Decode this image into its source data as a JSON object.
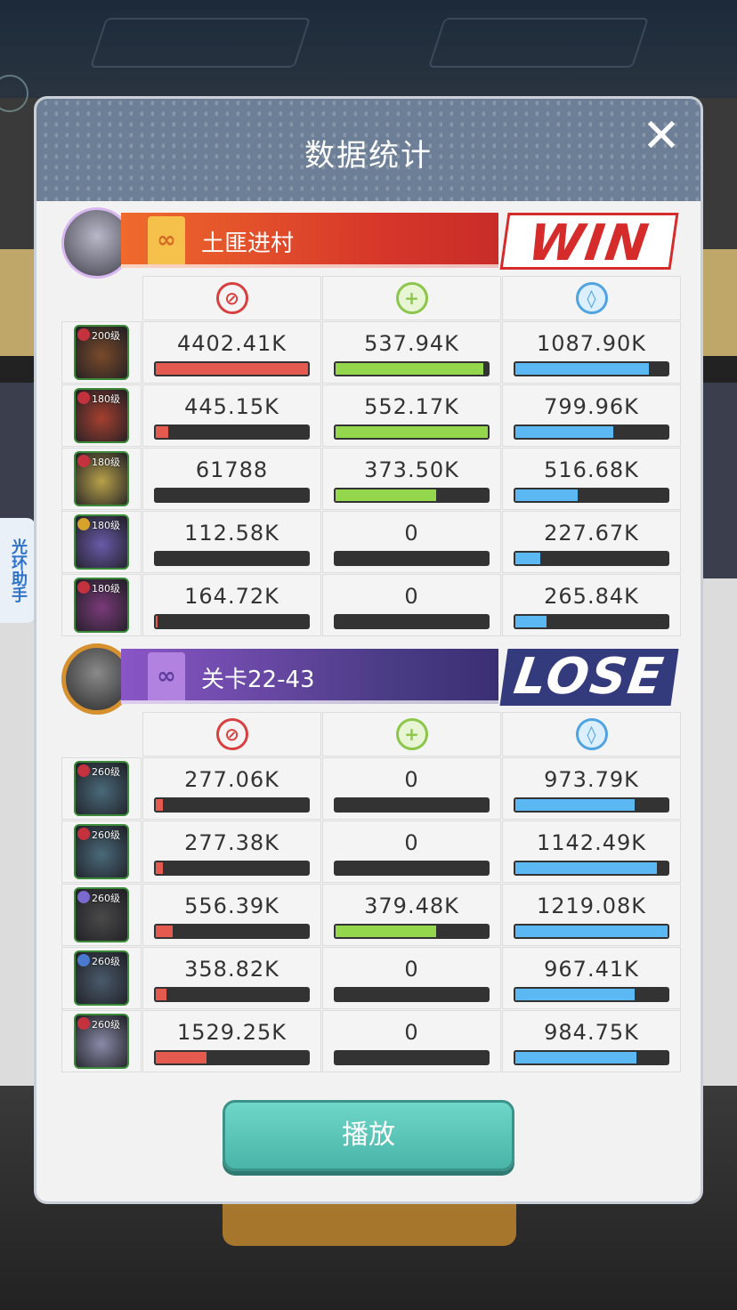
{
  "modal": {
    "title": "数据统计",
    "close_icon": "close-icon",
    "play_label": "播放"
  },
  "side_helper": {
    "label": "光环助手"
  },
  "teams": [
    {
      "name": "土匪进村",
      "result": "WIN",
      "colors": {
        "banner": "#d6362a",
        "result_text": "#d62b2b"
      },
      "heroes": [
        {
          "level": "200级",
          "damage": "4402.41K",
          "heal": "537.94K",
          "defense": "1087.90K",
          "damage_pct": 1.0,
          "heal_pct": 0.97,
          "defense_pct": 0.88
        },
        {
          "level": "180级",
          "damage": "445.15K",
          "heal": "552.17K",
          "defense": "799.96K",
          "damage_pct": 0.1,
          "heal_pct": 1.0,
          "defense_pct": 0.65
        },
        {
          "level": "180级",
          "damage": "61788",
          "heal": "373.50K",
          "defense": "516.68K",
          "damage_pct": 0.014,
          "heal_pct": 0.67,
          "defense_pct": 0.42
        },
        {
          "level": "180级",
          "damage": "112.58K",
          "heal": "0",
          "defense": "227.67K",
          "damage_pct": 0.025,
          "heal_pct": 0.0,
          "defense_pct": 0.18
        },
        {
          "level": "180级",
          "damage": "164.72K",
          "heal": "0",
          "defense": "265.84K",
          "damage_pct": 0.037,
          "heal_pct": 0.0,
          "defense_pct": 0.22
        }
      ]
    },
    {
      "name": "关卡22-43",
      "result": "LOSE",
      "colors": {
        "banner": "#4b3c86",
        "result_bg": "#343b7c"
      },
      "heroes": [
        {
          "level": "260级",
          "damage": "277.06K",
          "heal": "0",
          "defense": "973.79K",
          "damage_pct": 0.07,
          "heal_pct": 0.0,
          "defense_pct": 0.79
        },
        {
          "level": "260级",
          "damage": "277.38K",
          "heal": "0",
          "defense": "1142.49K",
          "damage_pct": 0.07,
          "heal_pct": 0.0,
          "defense_pct": 0.93
        },
        {
          "level": "260级",
          "damage": "556.39K",
          "heal": "379.48K",
          "defense": "1219.08K",
          "damage_pct": 0.13,
          "heal_pct": 0.67,
          "defense_pct": 1.0
        },
        {
          "level": "260级",
          "damage": "358.82K",
          "heal": "0",
          "defense": "967.41K",
          "damage_pct": 0.09,
          "heal_pct": 0.0,
          "defense_pct": 0.79
        },
        {
          "level": "260级",
          "damage": "1529.25K",
          "heal": "0",
          "defense": "984.75K",
          "damage_pct": 0.35,
          "heal_pct": 0.0,
          "defense_pct": 0.8
        }
      ]
    }
  ],
  "stat_icons": [
    "damage-icon",
    "heal-icon",
    "defense-icon"
  ]
}
